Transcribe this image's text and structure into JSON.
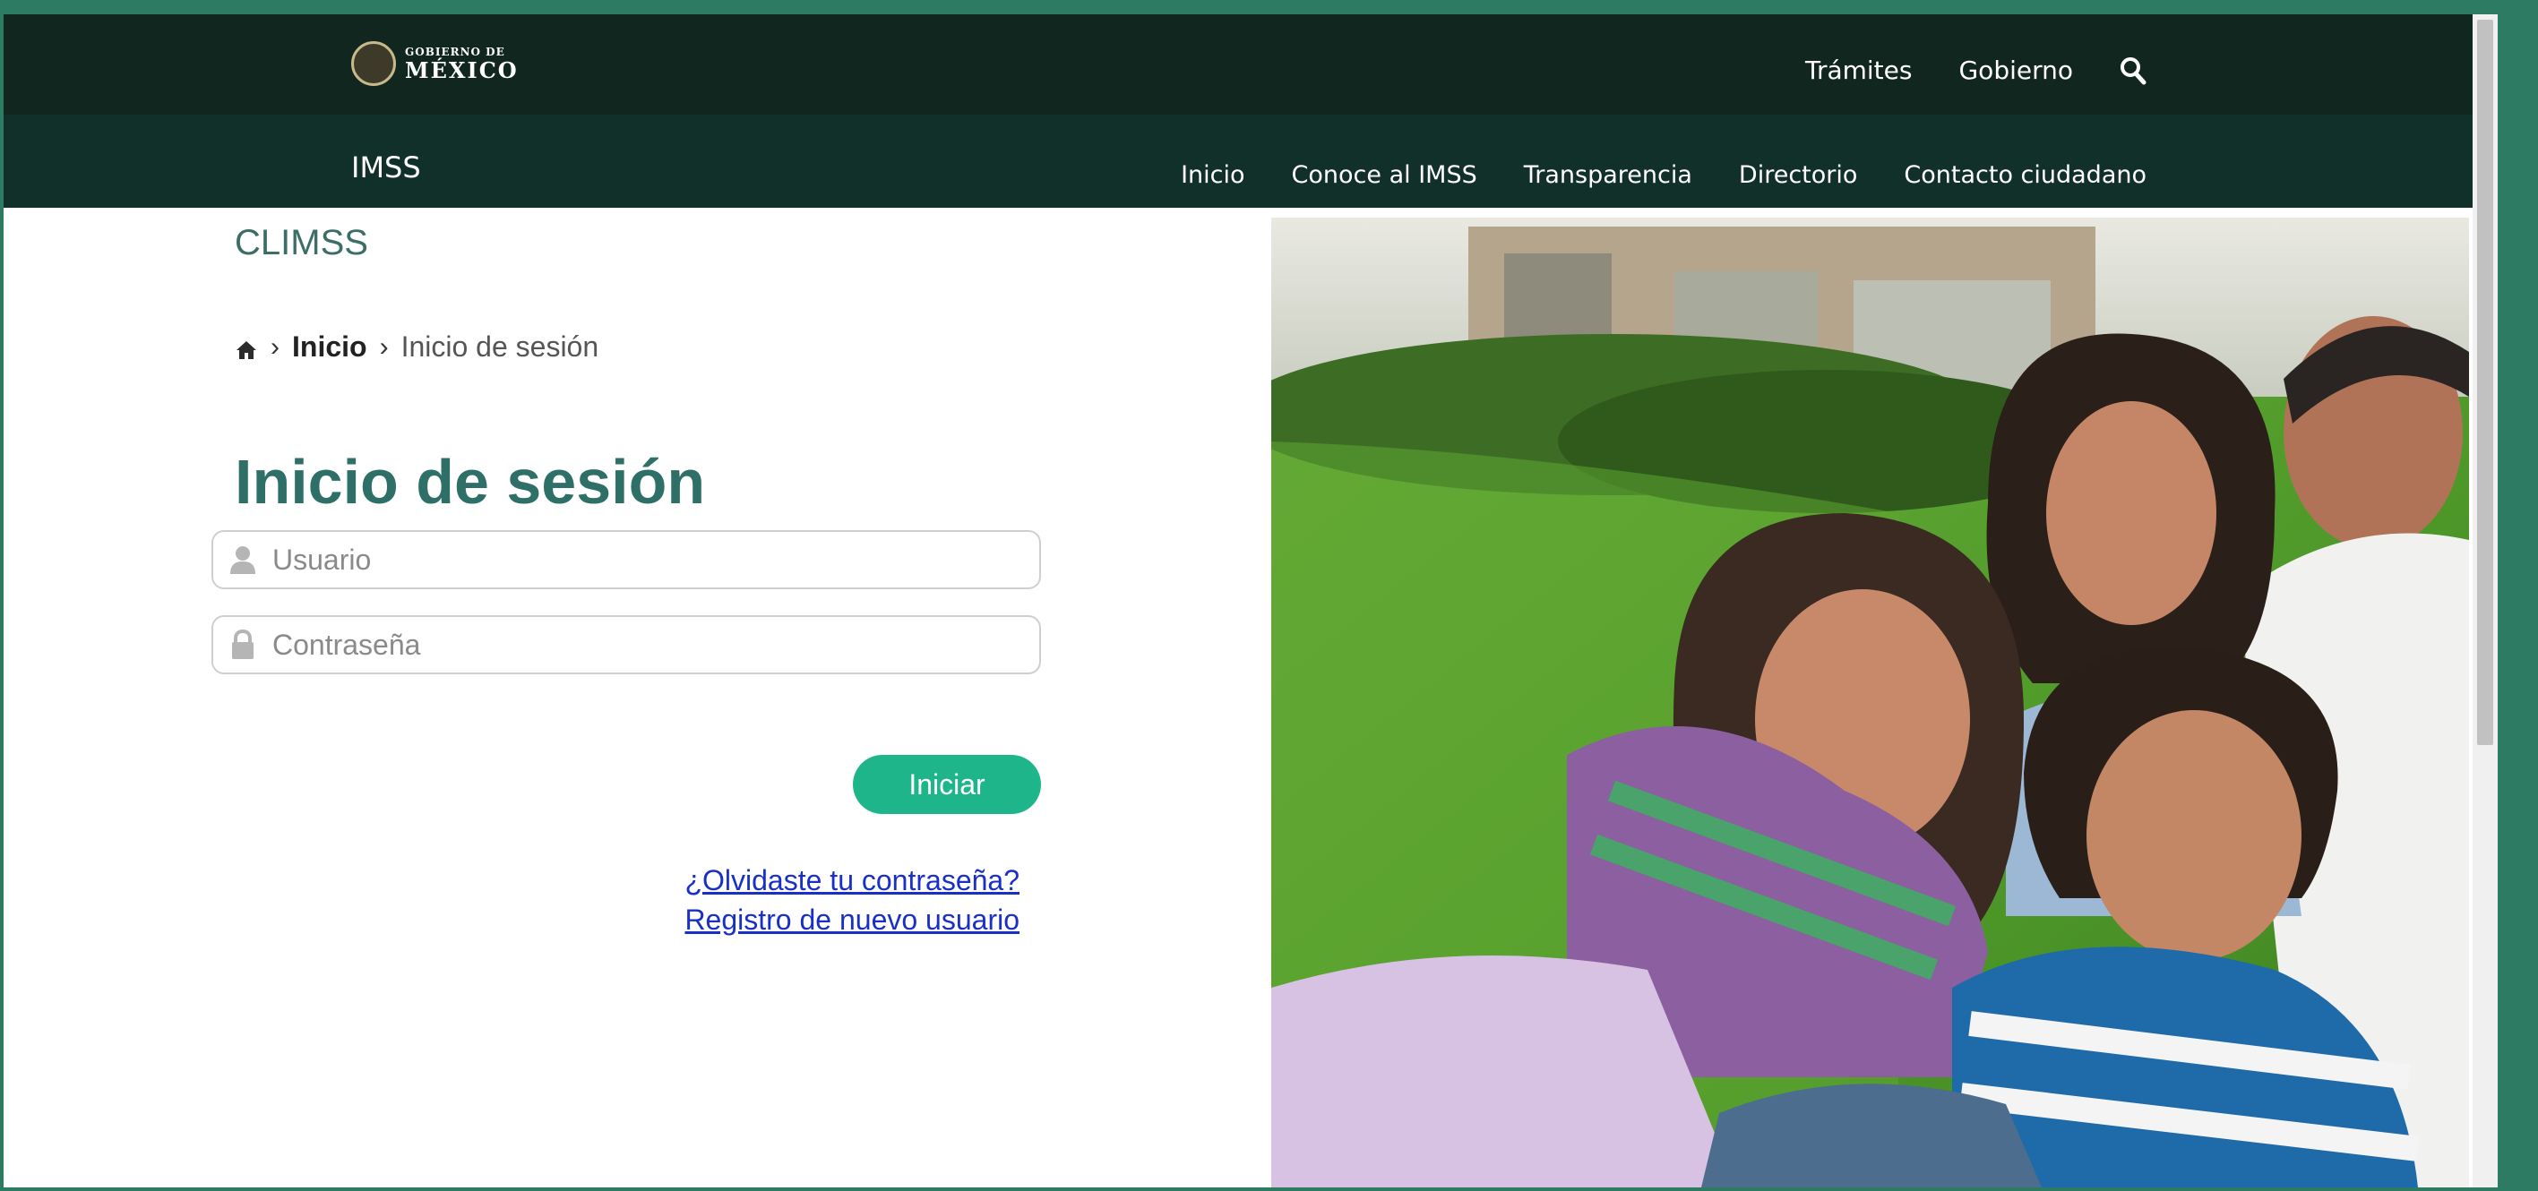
{
  "gov": {
    "logo_small": "GOBIERNO DE",
    "logo_big": "MÉXICO",
    "links": [
      "Trámites",
      "Gobierno"
    ],
    "search_icon": "search-icon"
  },
  "nav": {
    "brand": "IMSS",
    "items": [
      "Inicio",
      "Conoce al IMSS",
      "Transparencia",
      "Directorio",
      "Contacto ciudadano"
    ]
  },
  "main": {
    "section_title": "CLIMSS",
    "breadcrumb": {
      "home_icon": "home-icon",
      "separator": "›",
      "link": "Inicio",
      "current": "Inicio de sesión"
    },
    "title": "Inicio de sesión",
    "user_field": {
      "placeholder": "Usuario",
      "value": "",
      "icon": "user-icon"
    },
    "password_field": {
      "placeholder": "Contraseña",
      "value": "",
      "icon": "lock-icon"
    },
    "submit_label": "Iniciar",
    "forgot_link": "¿Olvidaste tu contraseña?",
    "register_link": "Registro de nuevo usuario"
  },
  "colors": {
    "gov_bar": "#10261f",
    "nav_bar": "#11302a",
    "title": "#2e7067",
    "button": "#1fb58a",
    "link": "#1a2fc7",
    "frame": "#2e7b64"
  }
}
